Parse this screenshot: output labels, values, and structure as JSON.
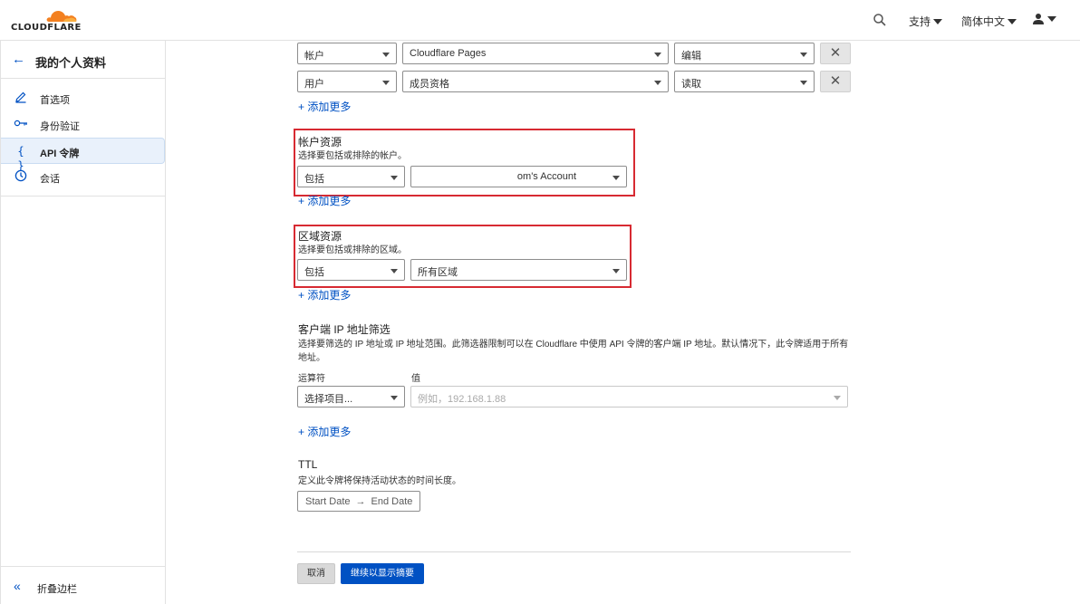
{
  "brand": {
    "logo_text": "CLOUDFLARE",
    "accent": "#f38020"
  },
  "topbar": {
    "support": "支持",
    "language": "简体中文"
  },
  "sidebar": {
    "back_title": "我的个人资料",
    "items": [
      {
        "label": "首选项",
        "icon": "pencil-icon"
      },
      {
        "label": "身份验证",
        "icon": "key-icon"
      },
      {
        "label": "API 令牌",
        "icon": "braces-icon",
        "active": true
      },
      {
        "label": "会话",
        "icon": "clock-icon"
      }
    ],
    "collapse_label": "折叠边栏"
  },
  "permissions": {
    "rows": [
      {
        "scope": "帐户",
        "resource": "Cloudflare Pages",
        "access": "编辑"
      },
      {
        "scope": "用户",
        "resource": "成员资格",
        "access": "读取"
      }
    ],
    "add_more": "+ 添加更多"
  },
  "account_resources": {
    "title": "帐户资源",
    "desc": "选择要包括或排除的帐户。",
    "mode": "包括",
    "value": "om's Account",
    "add_more": "+ 添加更多"
  },
  "zone_resources": {
    "title": "区域资源",
    "desc": "选择要包括或排除的区域。",
    "mode": "包括",
    "value": "所有区域",
    "add_more": "+ 添加更多"
  },
  "ip_filter": {
    "title": "客户端 IP 地址筛选",
    "desc_line1": "选择要筛选的 IP 地址或 IP 地址范围。此筛选器限制可以在 Cloudflare 中使用 API 令牌的客户端 IP 地址。默认情况下，此令牌适用于所有",
    "desc_line2": "地址。",
    "operator_label": "运算符",
    "value_label": "值",
    "operator_placeholder": "选择项目...",
    "value_placeholder": "例如，192.168.1.88",
    "add_more": "+ 添加更多"
  },
  "ttl": {
    "title": "TTL",
    "desc": "定义此令牌将保持活动状态的时间长度。",
    "start": "Start Date",
    "arrow": "→",
    "end": "End Date"
  },
  "actions": {
    "cancel": "取消",
    "continue": "继续以显示摘要"
  }
}
